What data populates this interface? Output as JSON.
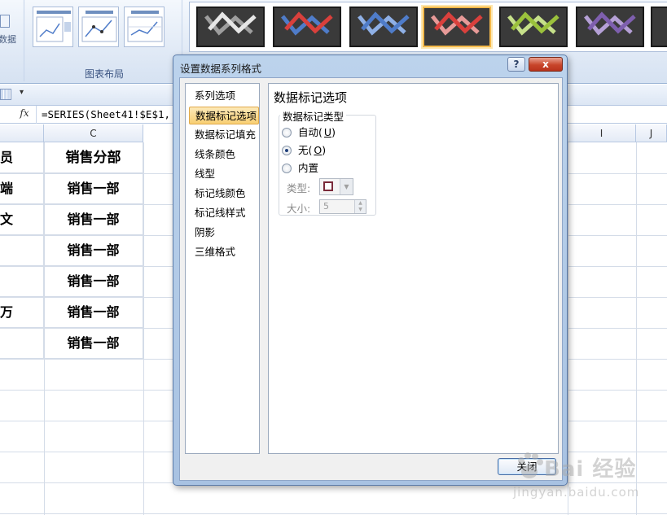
{
  "ribbon": {
    "data_group_label": "数据",
    "layout_group_label": "图表布局",
    "style_thumbs": [
      {
        "light": "#e6e6e6",
        "dark": "#9e9e9e"
      },
      {
        "light": "#d9403c",
        "dark": "#4f7cc9"
      },
      {
        "light": "#4f7cc9",
        "dark": "#8fb0e6"
      },
      {
        "light": "#d9403c",
        "dark": "#e79a98"
      },
      {
        "light": "#9bc13c",
        "dark": "#c6e08a"
      },
      {
        "light": "#7e5fae",
        "dark": "#b5a0d6"
      }
    ]
  },
  "formula_bar": {
    "fx_label": "fx",
    "formula": "=SERIES(Sheet41!$E$1,"
  },
  "sheet": {
    "columns": {
      "C": "C",
      "I": "I",
      "J": "J"
    },
    "header_row": {
      "col_b_partial": "员",
      "col_c": "销售分部"
    },
    "rows": [
      {
        "b": "端",
        "c": "销售一部"
      },
      {
        "b": "文",
        "c": "销售一部"
      },
      {
        "b": "",
        "c": "销售一部"
      },
      {
        "b": "",
        "c": "销售一部"
      },
      {
        "b": "万",
        "c": "销售一部"
      },
      {
        "b": "",
        "c": "销售一部"
      }
    ]
  },
  "dialog": {
    "title": "设置数据系列格式",
    "help_glyph": "?",
    "close_glyph": "x",
    "nav_items": [
      "系列选项",
      "数据标记选项",
      "数据标记填充",
      "线条颜色",
      "线型",
      "标记线颜色",
      "标记线样式",
      "阴影",
      "三维格式"
    ],
    "active_nav_index": 1,
    "pane_title": "数据标记选项",
    "group_label": "数据标记类型",
    "radios": [
      {
        "label": "自动",
        "key": "U",
        "checked": false
      },
      {
        "label": "无",
        "key": "O",
        "checked": true
      },
      {
        "label": "内置",
        "key": "",
        "checked": false
      }
    ],
    "type_label": "类型:",
    "size_label": "大小:",
    "size_value": "5",
    "close_button": "关闭"
  },
  "watermark": {
    "brand": "Bai 经验",
    "url": "jingyan.baidu.com"
  }
}
